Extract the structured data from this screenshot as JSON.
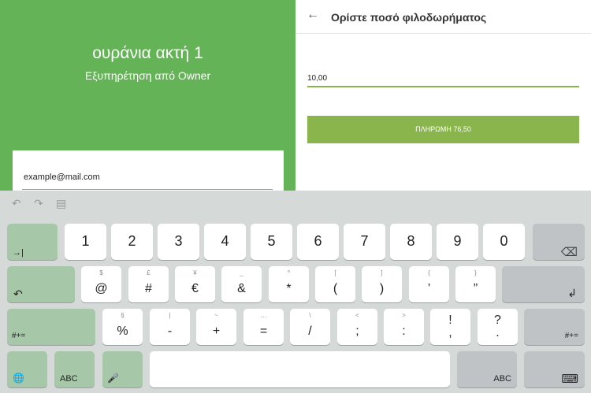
{
  "left_panel": {
    "venue_name": "ουράνια ακτή 1",
    "service_type": "Εξυπηρέτηση από Owner",
    "email_placeholder": "example@mail.com"
  },
  "right_panel": {
    "back_icon": "←",
    "title": "Ορίστε ποσό φιλοδωρήματος",
    "tip_amount": "10,00",
    "pay_button_label": "ΠΛΗΡΩΜΗ 76,50"
  },
  "keyboard": {
    "toolbar": {
      "undo": "↶",
      "redo": "↷",
      "paste": "▤"
    },
    "row1": [
      "1",
      "2",
      "3",
      "4",
      "5",
      "6",
      "7",
      "8",
      "9",
      "0"
    ],
    "tab_label": "→|",
    "backspace": "⌫",
    "row2": [
      {
        "main": "@",
        "sub": "$"
      },
      {
        "main": "#",
        "sub": "£"
      },
      {
        "main": "€",
        "sub": "¥"
      },
      {
        "main": "&",
        "sub": "_"
      },
      {
        "main": "*",
        "sub": "^"
      },
      {
        "main": "(",
        "sub": "["
      },
      {
        "main": ")",
        "sub": "]"
      },
      {
        "main": "’",
        "sub": "{"
      },
      {
        "main": "”",
        "sub": "}"
      }
    ],
    "undo_label": "↶",
    "enter_label": "↲",
    "row3": [
      {
        "main": "%",
        "sub": "§"
      },
      {
        "main": "-",
        "sub": "|"
      },
      {
        "main": "+",
        "sub": "~"
      },
      {
        "main": "=",
        "sub": "…"
      },
      {
        "main": "/",
        "sub": "\\"
      },
      {
        "main": ";",
        "sub": "<"
      },
      {
        "main": ":",
        "sub": ">"
      },
      {
        "main": "!",
        "sub": ""
      },
      {
        "main": "?",
        "sub": ""
      }
    ],
    "row3_below": [
      "",
      ",",
      "."
    ],
    "symbols_label": "#+=",
    "globe": "🌐",
    "abc_label": "ABC",
    "mic": "🎤",
    "hide_keyboard": "⌨"
  }
}
